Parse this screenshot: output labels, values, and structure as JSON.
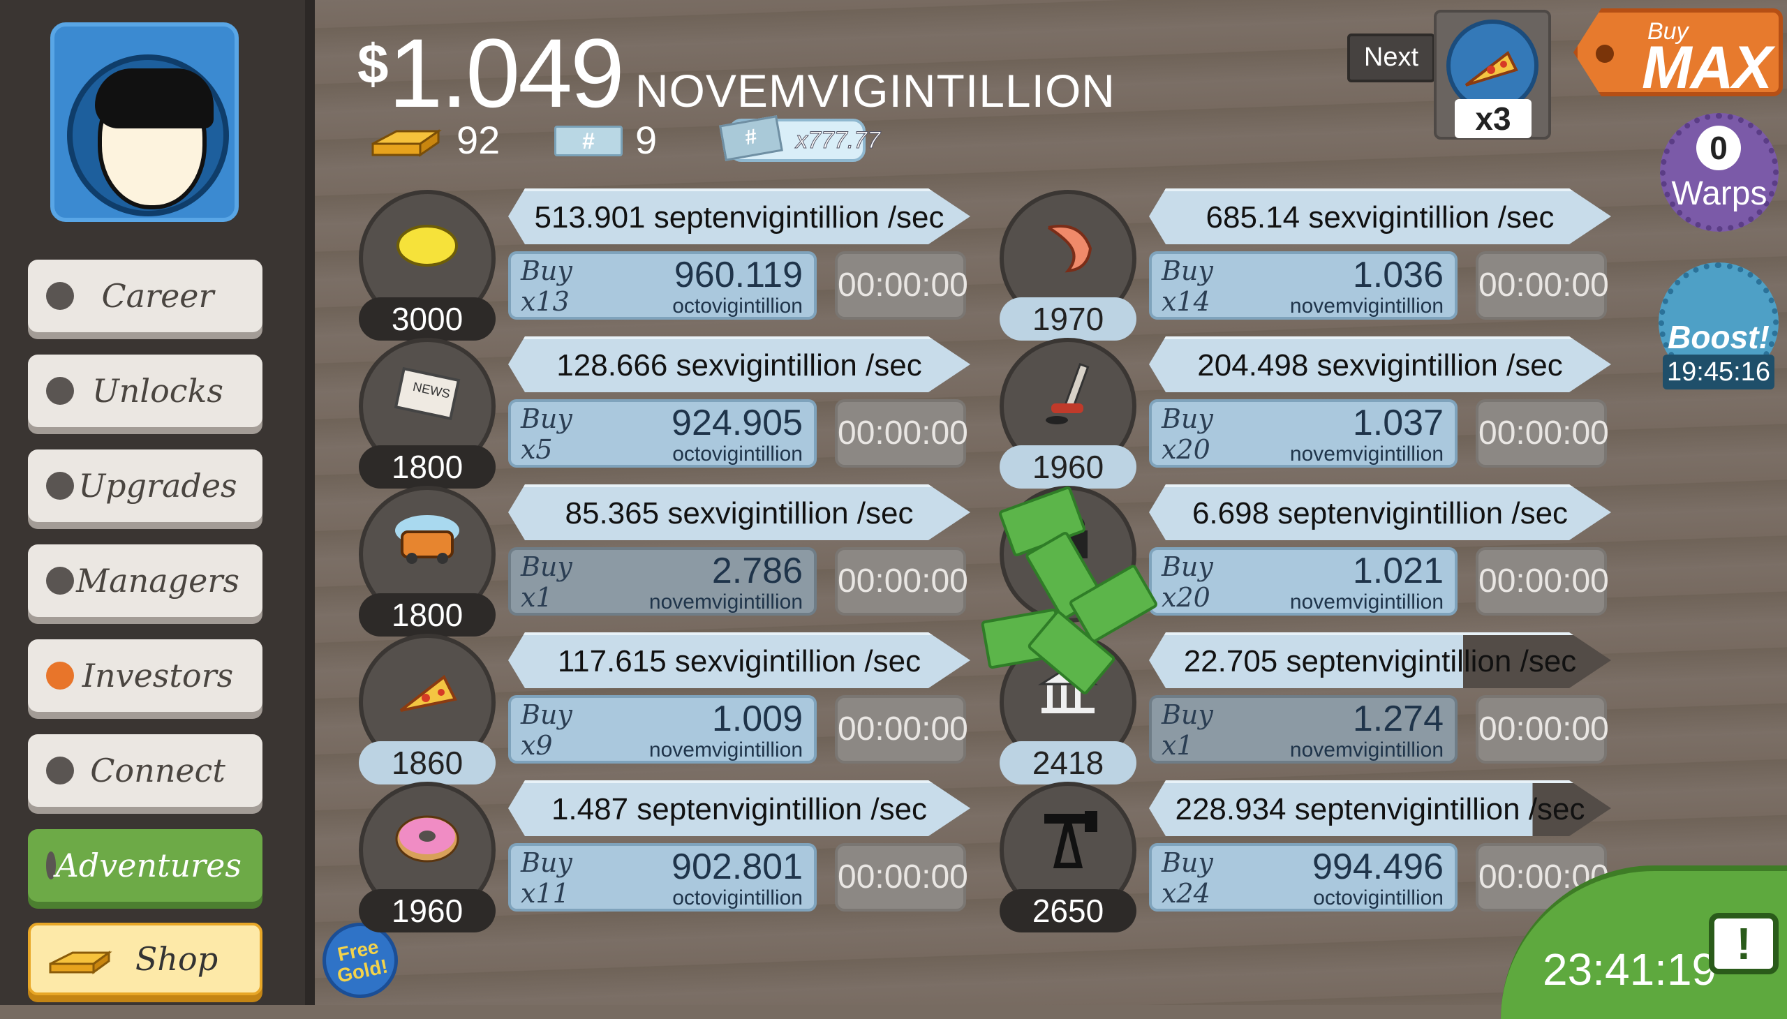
{
  "sidebar": {
    "nav": [
      {
        "label": "Career",
        "active": false
      },
      {
        "label": "Unlocks",
        "active": false
      },
      {
        "label": "Upgrades",
        "active": false
      },
      {
        "label": "Managers",
        "active": false
      },
      {
        "label": "Investors",
        "active": true
      },
      {
        "label": "Connect",
        "active": false
      },
      {
        "label": "Adventures",
        "active": false
      },
      {
        "label": "Shop",
        "active": false
      }
    ],
    "free_gold": "Free Gold!"
  },
  "header": {
    "currency_symbol": "$",
    "money_value": "1.049",
    "money_unit": "NOVEMVIGINTILLION",
    "gold_count": "92",
    "megabucks_count": "9",
    "mega_ticket": "x777.77"
  },
  "top_right": {
    "next_label": "Next",
    "multiplier_label": "x3",
    "multiplier_icon": "pizza-icon",
    "buy_max_top": "Buy",
    "buy_max_bottom": "MAX",
    "warps_count": "0",
    "warps_label": "Warps",
    "boost_label": "Boost!",
    "boost_timer": "19:45:16",
    "tv_clock": "23:41:19"
  },
  "businesses_left": [
    {
      "icon": "lemon-icon",
      "count": "3000",
      "rate": "513.901 septenvigintillion /sec",
      "buy_label": "Buy",
      "buy_qty": "x13",
      "cost_value": "960.119",
      "cost_unit": "octovigintillion",
      "timer": "00:00:00",
      "affordable": true
    },
    {
      "icon": "newspaper-icon",
      "count": "1800",
      "rate": "128.666 sexvigintillion /sec",
      "buy_label": "Buy",
      "buy_qty": "x5",
      "cost_value": "924.905",
      "cost_unit": "octovigintillion",
      "timer": "00:00:00",
      "affordable": true
    },
    {
      "icon": "car-wash-icon",
      "count": "1800",
      "rate": "85.365 sexvigintillion /sec",
      "buy_label": "Buy",
      "buy_qty": "x1",
      "cost_value": "2.786",
      "cost_unit": "novemvigintillion",
      "timer": "00:00:00",
      "affordable": false
    },
    {
      "icon": "pizza-icon",
      "count": "1860",
      "rate": "117.615 sexvigintillion /sec",
      "buy_label": "Buy",
      "buy_qty": "x9",
      "cost_value": "1.009",
      "cost_unit": "novemvigintillion",
      "timer": "00:00:00",
      "affordable": true
    },
    {
      "icon": "donut-icon",
      "count": "1960",
      "rate": "1.487 septenvigintillion /sec",
      "buy_label": "Buy",
      "buy_qty": "x11",
      "cost_value": "902.801",
      "cost_unit": "octovigintillion",
      "timer": "00:00:00",
      "affordable": true
    }
  ],
  "businesses_right": [
    {
      "icon": "shrimp-icon",
      "count": "1970",
      "rate": "685.14 sexvigintillion /sec",
      "buy_label": "Buy",
      "buy_qty": "x14",
      "cost_value": "1.036",
      "cost_unit": "novemvigintillion",
      "timer": "00:00:00",
      "affordable": true,
      "progress": 1
    },
    {
      "icon": "hockey-stick-icon",
      "count": "1960",
      "rate": "204.498 sexvigintillion /sec",
      "buy_label": "Buy",
      "buy_qty": "x20",
      "cost_value": "1.037",
      "cost_unit": "novemvigintillion",
      "timer": "00:00:00",
      "affordable": true,
      "progress": 1
    },
    {
      "icon": "movie-camera-icon",
      "count": "",
      "rate": "6.698 septenvigintillion /sec",
      "buy_label": "Buy",
      "buy_qty": "x20",
      "cost_value": "1.021",
      "cost_unit": "novemvigintillion",
      "timer": "00:00:00",
      "affordable": true,
      "progress": 1
    },
    {
      "icon": "bank-icon",
      "count": "2418",
      "rate": "22.705 septenvigintillion /sec",
      "buy_label": "Buy",
      "buy_qty": "x1",
      "cost_value": "1.274",
      "cost_unit": "novemvigintillion",
      "timer": "00:00:00",
      "affordable": false,
      "progress": 0.68
    },
    {
      "icon": "oil-rig-icon",
      "count": "2650",
      "rate": "228.934 septenvigintillion /sec",
      "buy_label": "Buy",
      "buy_qty": "x24",
      "cost_value": "994.496",
      "cost_unit": "octovigintillion",
      "timer": "00:00:00",
      "affordable": true,
      "progress": 0.83
    }
  ],
  "colors": {
    "accent_orange": "#e77a2d",
    "sidebar_green": "#6daa47",
    "shop_gold": "#e8a727"
  }
}
